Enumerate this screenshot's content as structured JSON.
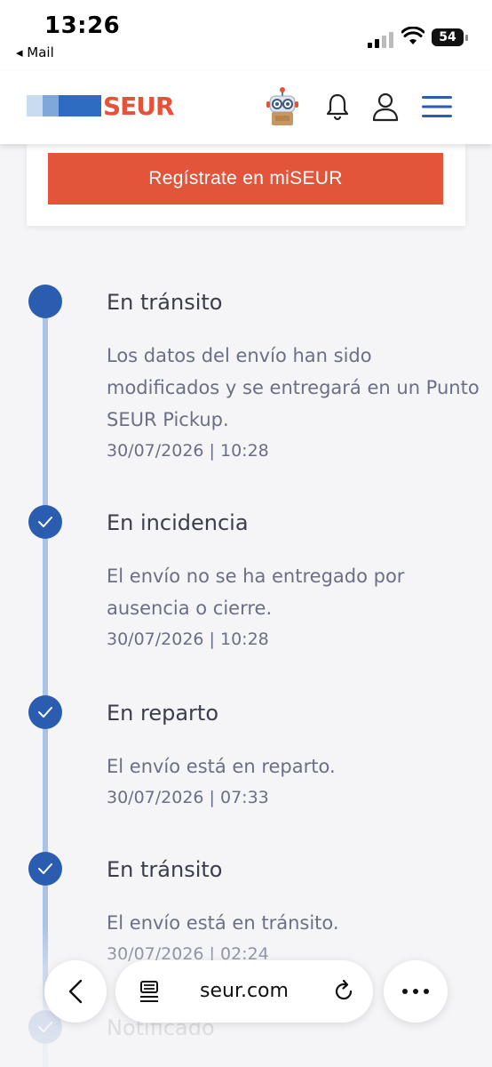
{
  "status_bar": {
    "time": "13:26",
    "back_app": "◂ Mail",
    "battery": "54"
  },
  "header": {
    "logo_text": "SEUR",
    "icons": [
      "robot-assistant-icon",
      "bell-icon",
      "user-icon",
      "menu-icon"
    ]
  },
  "card": {
    "register_label": "Regístrate en miSEUR"
  },
  "timeline": [
    {
      "title": "En tránsito",
      "description": "Los datos del envío han sido modificados y se entregará en un Punto SEUR Pickup.",
      "date": "30/07/2026 | 10:28",
      "state": "current"
    },
    {
      "title": "En incidencia",
      "description": "El envío no se ha entregado por ausencia o cierre.",
      "date": "30/07/2026 | 10:28",
      "state": "done"
    },
    {
      "title": "En reparto",
      "description": "El envío está en reparto.",
      "date": "30/07/2026 | 07:33",
      "state": "done"
    },
    {
      "title": "En tránsito",
      "description": "El envío está en tránsito.",
      "date": "30/07/2026 | 02:24",
      "state": "done"
    },
    {
      "title": "Notificado",
      "description": "",
      "date": "",
      "state": "done"
    }
  ],
  "browser": {
    "url": "seur.com"
  },
  "colors": {
    "brand_orange": "#e2553a",
    "brand_blue": "#2a5db0",
    "timeline_line": "#a9c3e6"
  }
}
